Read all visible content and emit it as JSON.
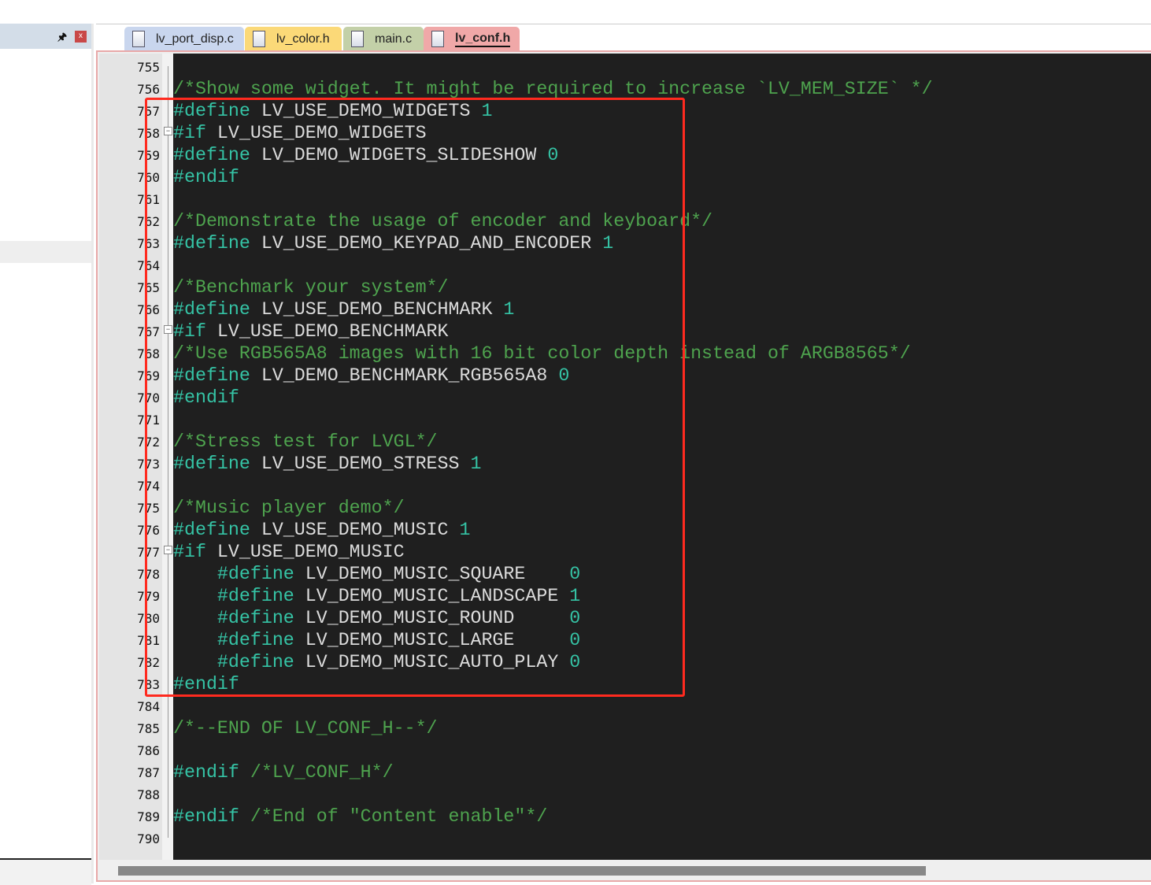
{
  "left_panel": {
    "pin_icon": "pin-icon",
    "close_label": "x"
  },
  "tabs": [
    {
      "label": "lv_port_disp.c",
      "color": "#c9d6ee",
      "active": false
    },
    {
      "label": "lv_color.h",
      "color": "#fbd978",
      "active": false
    },
    {
      "label": "main.c",
      "color": "#c3d0a8",
      "active": false
    },
    {
      "label": "lv_conf.h",
      "color": "#f0a8a8",
      "active": true
    }
  ],
  "colors": {
    "comment": "#4ea34e",
    "directive": "#35c3a5",
    "identifier": "#dcdcdc",
    "number": "#35c3a5",
    "highlight_box": "#ff2a1f"
  },
  "lines": [
    {
      "n": "755",
      "t": []
    },
    {
      "n": "756",
      "t": [
        [
          "c",
          "/*Show some widget. It might be required to increase `LV_MEM_SIZE` */"
        ]
      ]
    },
    {
      "n": "757",
      "t": [
        [
          "d",
          "#define "
        ],
        [
          "i",
          "LV_USE_DEMO_WIDGETS "
        ],
        [
          "n",
          "1"
        ]
      ]
    },
    {
      "n": "758",
      "fold": true,
      "t": [
        [
          "d",
          "#if "
        ],
        [
          "i",
          "LV_USE_DEMO_WIDGETS"
        ]
      ]
    },
    {
      "n": "759",
      "t": [
        [
          "d",
          "#define "
        ],
        [
          "i",
          "LV_DEMO_WIDGETS_SLIDESHOW "
        ],
        [
          "n",
          "0"
        ]
      ]
    },
    {
      "n": "760",
      "t": [
        [
          "d",
          "#endif"
        ]
      ]
    },
    {
      "n": "761",
      "t": []
    },
    {
      "n": "762",
      "t": [
        [
          "c",
          "/*Demonstrate the usage of encoder and keyboard*/"
        ]
      ]
    },
    {
      "n": "763",
      "t": [
        [
          "d",
          "#define "
        ],
        [
          "i",
          "LV_USE_DEMO_KEYPAD_AND_ENCODER "
        ],
        [
          "n",
          "1"
        ]
      ]
    },
    {
      "n": "764",
      "t": []
    },
    {
      "n": "765",
      "t": [
        [
          "c",
          "/*Benchmark your system*/"
        ]
      ]
    },
    {
      "n": "766",
      "t": [
        [
          "d",
          "#define "
        ],
        [
          "i",
          "LV_USE_DEMO_BENCHMARK "
        ],
        [
          "n",
          "1"
        ]
      ]
    },
    {
      "n": "767",
      "fold": true,
      "t": [
        [
          "d",
          "#if "
        ],
        [
          "i",
          "LV_USE_DEMO_BENCHMARK"
        ]
      ]
    },
    {
      "n": "768",
      "t": [
        [
          "c",
          "/*Use RGB565A8 images with 16 bit color depth instead of ARGB8565*/"
        ]
      ]
    },
    {
      "n": "769",
      "t": [
        [
          "d",
          "#define "
        ],
        [
          "i",
          "LV_DEMO_BENCHMARK_RGB565A8 "
        ],
        [
          "n",
          "0"
        ]
      ]
    },
    {
      "n": "770",
      "t": [
        [
          "d",
          "#endif"
        ]
      ]
    },
    {
      "n": "771",
      "t": []
    },
    {
      "n": "772",
      "t": [
        [
          "c",
          "/*Stress test for LVGL*/"
        ]
      ]
    },
    {
      "n": "773",
      "t": [
        [
          "d",
          "#define "
        ],
        [
          "i",
          "LV_USE_DEMO_STRESS "
        ],
        [
          "n",
          "1"
        ]
      ]
    },
    {
      "n": "774",
      "t": []
    },
    {
      "n": "775",
      "t": [
        [
          "c",
          "/*Music player demo*/"
        ]
      ]
    },
    {
      "n": "776",
      "t": [
        [
          "d",
          "#define "
        ],
        [
          "i",
          "LV_USE_DEMO_MUSIC "
        ],
        [
          "n",
          "1"
        ]
      ]
    },
    {
      "n": "777",
      "fold": true,
      "t": [
        [
          "d",
          "#if "
        ],
        [
          "i",
          "LV_USE_DEMO_MUSIC"
        ]
      ]
    },
    {
      "n": "778",
      "t": [
        [
          "d",
          "    #define "
        ],
        [
          "i",
          "LV_DEMO_MUSIC_SQUARE    "
        ],
        [
          "n",
          "0"
        ]
      ]
    },
    {
      "n": "779",
      "t": [
        [
          "d",
          "    #define "
        ],
        [
          "i",
          "LV_DEMO_MUSIC_LANDSCAPE "
        ],
        [
          "n",
          "1"
        ]
      ]
    },
    {
      "n": "780",
      "t": [
        [
          "d",
          "    #define "
        ],
        [
          "i",
          "LV_DEMO_MUSIC_ROUND     "
        ],
        [
          "n",
          "0"
        ]
      ]
    },
    {
      "n": "781",
      "t": [
        [
          "d",
          "    #define "
        ],
        [
          "i",
          "LV_DEMO_MUSIC_LARGE     "
        ],
        [
          "n",
          "0"
        ]
      ]
    },
    {
      "n": "782",
      "t": [
        [
          "d",
          "    #define "
        ],
        [
          "i",
          "LV_DEMO_MUSIC_AUTO_PLAY "
        ],
        [
          "n",
          "0"
        ]
      ]
    },
    {
      "n": "783",
      "t": [
        [
          "d",
          "#endif"
        ]
      ]
    },
    {
      "n": "784",
      "t": []
    },
    {
      "n": "785",
      "t": [
        [
          "c",
          "/*--END OF LV_CONF_H--*/"
        ]
      ]
    },
    {
      "n": "786",
      "t": []
    },
    {
      "n": "787",
      "t": [
        [
          "d",
          "#endif "
        ],
        [
          "c",
          "/*LV_CONF_H*/"
        ]
      ]
    },
    {
      "n": "788",
      "t": []
    },
    {
      "n": "789",
      "t": [
        [
          "d",
          "#endif "
        ],
        [
          "c",
          "/*End of \"Content enable\"*/"
        ]
      ]
    },
    {
      "n": "790",
      "t": []
    }
  ]
}
